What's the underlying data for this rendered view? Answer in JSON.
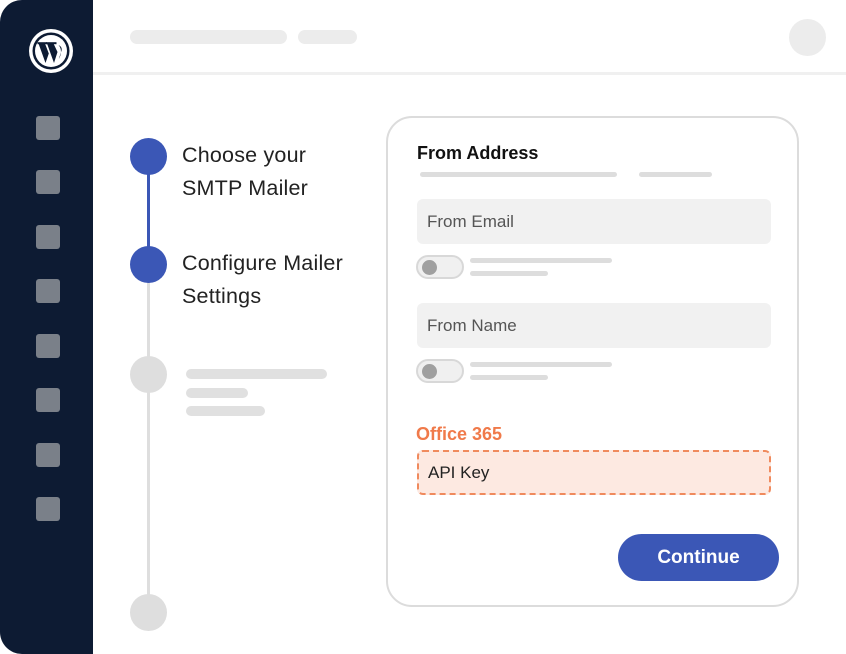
{
  "colors": {
    "sidebar_bg": "#0d1b33",
    "accent": "#3b57b6",
    "mailer_accent": "#f07a4a",
    "api_field_bg": "#fde9e1",
    "api_field_border": "#f08a5d"
  },
  "sidebar": {
    "logo_icon": "wordpress-logo",
    "items": [
      "menu-square",
      "menu-square",
      "menu-square",
      "menu-square",
      "menu-square",
      "menu-square",
      "menu-square",
      "menu-square"
    ]
  },
  "steps": [
    {
      "label": "Choose your\nSMTP Mailer",
      "status": "done"
    },
    {
      "label": "Configure Mailer\nSettings",
      "status": "done"
    },
    {
      "label": "",
      "status": "todo"
    },
    {
      "label": "",
      "status": "todo"
    }
  ],
  "form": {
    "title": "From Address",
    "from_email_placeholder": "From Email",
    "from_name_placeholder": "From Name",
    "mailer_label": "Office 365",
    "api_key_placeholder": "API Key",
    "continue_label": "Continue"
  }
}
